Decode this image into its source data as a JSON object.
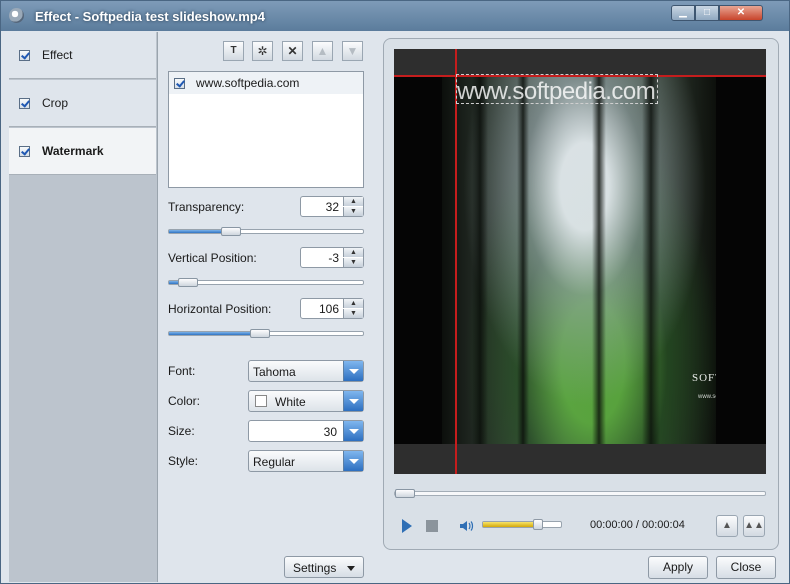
{
  "window": {
    "title": "Effect - Softpedia test slideshow.mp4"
  },
  "nav": {
    "items": [
      {
        "label": "Effect",
        "checked": true
      },
      {
        "label": "Crop",
        "checked": true
      },
      {
        "label": "Watermark",
        "checked": true,
        "active": true
      }
    ]
  },
  "toolbar": {
    "icons": [
      "add-text-watermark-icon",
      "add-image-watermark-icon",
      "delete-icon",
      "move-up-icon",
      "move-down-icon"
    ]
  },
  "watermark_list": [
    {
      "text": "www.softpedia.com",
      "checked": true
    }
  ],
  "transparency": {
    "label": "Transparency:",
    "value": "32",
    "level": 0.32
  },
  "vertical_position": {
    "label": "Vertical Position:",
    "value": "-3",
    "level": 0.1
  },
  "horizontal_position": {
    "label": "Horizontal Position:",
    "value": "106",
    "level": 0.47
  },
  "font": {
    "label": "Font:",
    "value": "Tahoma"
  },
  "color": {
    "label": "Color:",
    "value": "White"
  },
  "size": {
    "label": "Size:",
    "value": "30"
  },
  "style": {
    "label": "Style:",
    "value": "Regular"
  },
  "settings_button": "Settings",
  "preview": {
    "watermark_text": "www.softpedia.com",
    "image_logo": "SOFTPEDIA",
    "image_url": "www.softpedia.com",
    "time": "00:00:00 / 00:00:04",
    "volume_level": 0.7
  },
  "buttons": {
    "apply": "Apply",
    "close": "Close"
  }
}
